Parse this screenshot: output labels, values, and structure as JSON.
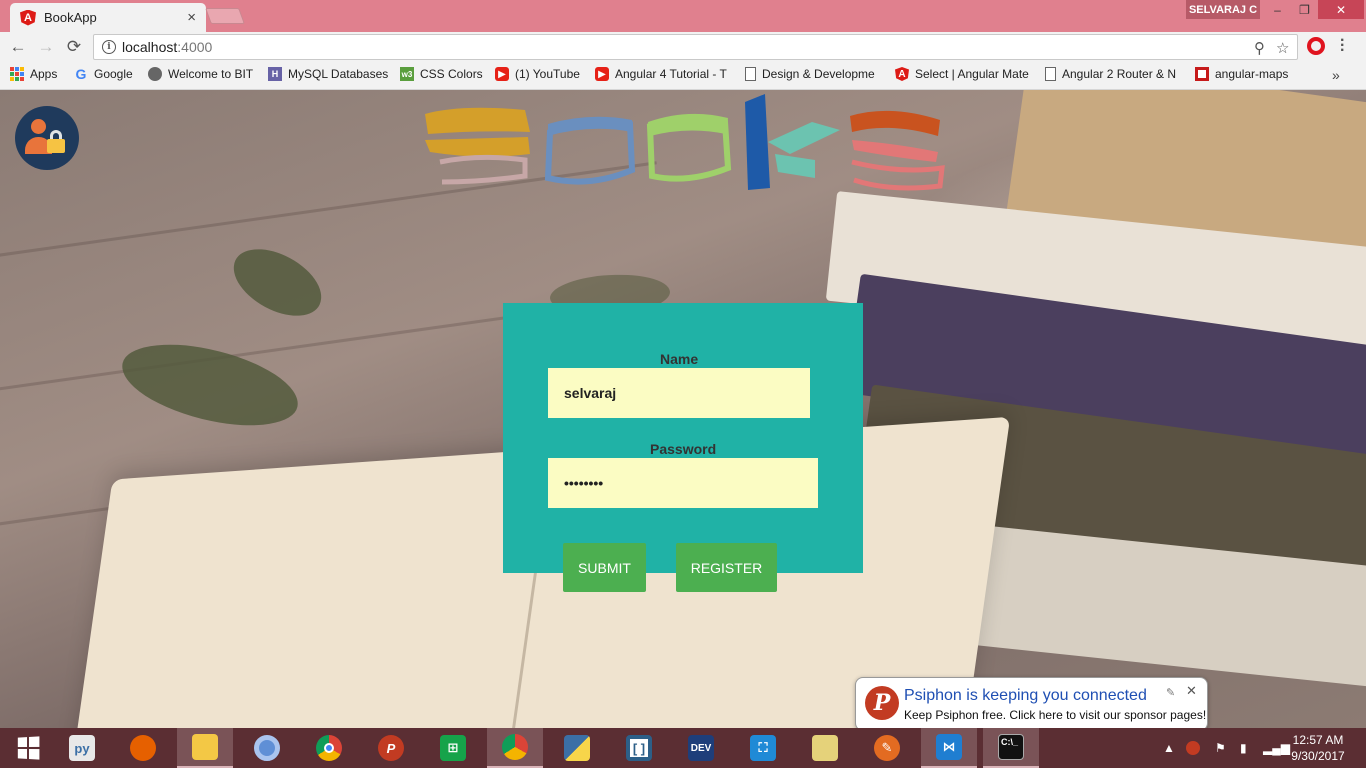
{
  "browser": {
    "tab_title": "BookApp",
    "tab_close": "×",
    "user": "SELVARAJ C",
    "window_controls": {
      "minimize": "–",
      "maximize": "❐",
      "close": "✕"
    },
    "nav": {
      "back": "←",
      "forward": "→",
      "reload": "⟳"
    },
    "url_host": "localhost",
    "url_port": ":4000",
    "bookmarks_overflow": "»"
  },
  "bookmarks": [
    {
      "label": "Apps",
      "icon": "apps-grid-icon"
    },
    {
      "label": "Google",
      "icon": "google-icon"
    },
    {
      "label": "Welcome to BIT",
      "icon": "bit-icon"
    },
    {
      "label": "MySQL Databases",
      "icon": "heroku-icon"
    },
    {
      "label": "CSS Colors",
      "icon": "w3schools-icon"
    },
    {
      "label": "(1) YouTube",
      "icon": "youtube-icon"
    },
    {
      "label": "Angular 4 Tutorial - T",
      "icon": "youtube-icon"
    },
    {
      "label": "Design & Developme",
      "icon": "file-icon"
    },
    {
      "label": "Select | Angular Mate",
      "icon": "angular-icon"
    },
    {
      "label": "Angular 2 Router & N",
      "icon": "file-icon"
    },
    {
      "label": "angular-maps",
      "icon": "angular-maps-icon"
    }
  ],
  "login": {
    "name_label": "Name",
    "name_value": "selvaraj",
    "password_label": "Password",
    "password_value": "••••••••",
    "submit_label": "SUBMIT",
    "register_label": "REGISTER"
  },
  "notification": {
    "title": "Psiphon is keeping you connected",
    "body": "Keep Psiphon free. Click here to visit our sponsor pages!",
    "logo_letter": "P"
  },
  "taskbar": {
    "time": "12:57 AM",
    "date": "9/30/2017",
    "icons": [
      "windows-start-icon",
      "python-file-icon",
      "firefox-icon",
      "file-explorer-icon",
      "chromium-icon",
      "chrome-icon",
      "psiphon-icon",
      "store-icon",
      "chrome-user-icon",
      "python-icon",
      "brackets-icon",
      "devcpp-icon",
      "screen-capture-icon",
      "folder-icon",
      "wrench-icon",
      "vscode-icon",
      "cmd-icon"
    ]
  },
  "colors": {
    "card": "#20b2a6",
    "input_bg": "#fbfcc3",
    "button": "#4caf50",
    "titlebar": "#e0808e",
    "taskbar": "#5b2e33"
  }
}
